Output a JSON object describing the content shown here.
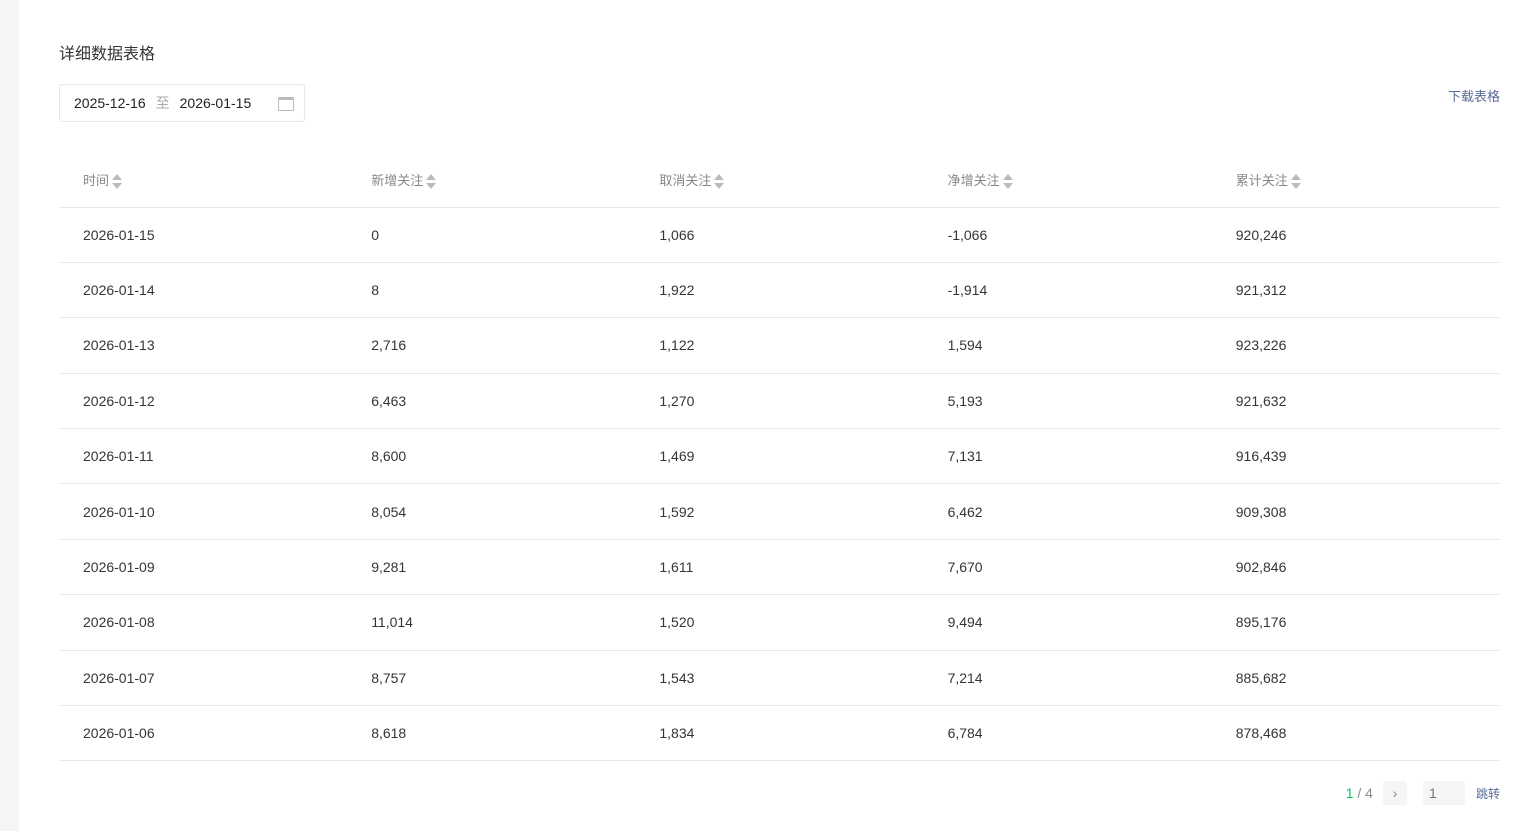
{
  "title": "详细数据表格",
  "date_range": {
    "start": "2025-12-16",
    "separator": "至",
    "end": "2026-01-15"
  },
  "download_label": "下载表格",
  "columns": [
    "时间",
    "新增关注",
    "取消关注",
    "净增关注",
    "累计关注"
  ],
  "rows": [
    [
      "2026-01-15",
      "0",
      "1,066",
      "-1,066",
      "920,246"
    ],
    [
      "2026-01-14",
      "8",
      "1,922",
      "-1,914",
      "921,312"
    ],
    [
      "2026-01-13",
      "2,716",
      "1,122",
      "1,594",
      "923,226"
    ],
    [
      "2026-01-12",
      "6,463",
      "1,270",
      "5,193",
      "921,632"
    ],
    [
      "2026-01-11",
      "8,600",
      "1,469",
      "7,131",
      "916,439"
    ],
    [
      "2026-01-10",
      "8,054",
      "1,592",
      "6,462",
      "909,308"
    ],
    [
      "2026-01-09",
      "9,281",
      "1,611",
      "7,670",
      "902,846"
    ],
    [
      "2026-01-08",
      "11,014",
      "1,520",
      "9,494",
      "895,176"
    ],
    [
      "2026-01-07",
      "8,757",
      "1,543",
      "7,214",
      "885,682"
    ],
    [
      "2026-01-06",
      "8,618",
      "1,834",
      "6,784",
      "878,468"
    ]
  ],
  "pagination": {
    "current": "1",
    "total": "/ 4",
    "next": "›",
    "page_input_placeholder": "1",
    "jump_label": "跳转"
  }
}
